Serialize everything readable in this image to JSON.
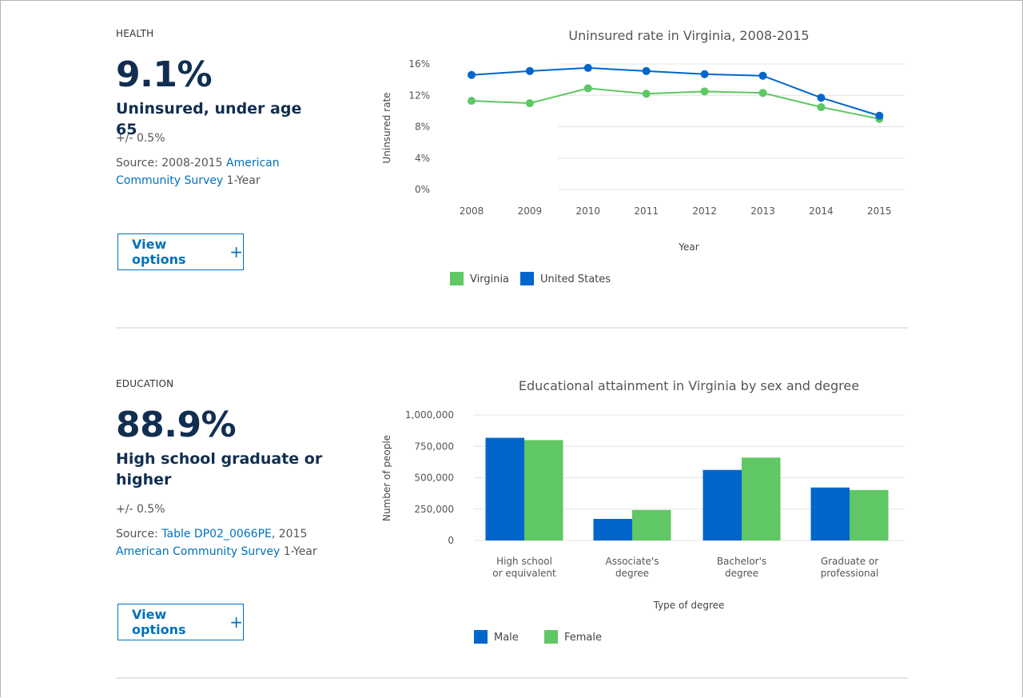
{
  "sections": [
    {
      "kicker": "HEALTH",
      "value": "9.1%",
      "label": "Uninsured, under age 65",
      "moe": "+/- 0.5%",
      "source_prefix": "Source: 2008-2015 ",
      "source_link": "American Community Survey",
      "source_suffix": " 1-Year",
      "button": "View options"
    },
    {
      "kicker": "EDUCATION",
      "value": "88.9%",
      "label": "High school graduate or higher",
      "moe": "+/- 0.5%",
      "source_prefix": "Source: ",
      "source_link": "Table DP02_0066PE",
      "source_mid": ", 2015 ",
      "source_link2": "American Community Survey",
      "source_suffix": " 1-Year",
      "button": "View options"
    }
  ],
  "chart_data": [
    {
      "type": "line",
      "title": "Uninsured rate in Virginia, 2008-2015",
      "xlabel": "Year",
      "ylabel": "Uninsured rate",
      "x": [
        "2008",
        "2009",
        "2010",
        "2011",
        "2012",
        "2013",
        "2014",
        "2015"
      ],
      "ylim": [
        0,
        16
      ],
      "yticks": [
        0,
        4,
        8,
        12,
        16
      ],
      "ytick_labels": [
        "0%",
        "4%",
        "8%",
        "12%",
        "16%"
      ],
      "series": [
        {
          "name": "Virginia",
          "color": "#5fc763",
          "values": [
            11.3,
            11.0,
            12.9,
            12.2,
            12.5,
            12.3,
            10.5,
            9.0
          ]
        },
        {
          "name": "United States",
          "color": "#0066cc",
          "values": [
            14.6,
            15.1,
            15.5,
            15.1,
            14.7,
            14.5,
            11.7,
            9.4
          ]
        }
      ],
      "legend": "bottom-left",
      "grid": true
    },
    {
      "type": "bar",
      "title": "Educational attainment in Virginia by sex and degree",
      "xlabel": "Type of degree",
      "ylabel": "Number of people",
      "categories": [
        "High school or equivalent",
        "Associate's degree",
        "Bachelor's degree",
        "Graduate or professional"
      ],
      "category_lines": [
        [
          "High school",
          "or equivalent"
        ],
        [
          "Associate's",
          "degree"
        ],
        [
          "Bachelor's",
          "degree"
        ],
        [
          "Graduate or",
          "professional"
        ]
      ],
      "ylim": [
        0,
        1000000
      ],
      "yticks": [
        0,
        250000,
        500000,
        750000,
        1000000
      ],
      "ytick_labels": [
        "0",
        "250,000",
        "500,000",
        "750,000",
        "1,000,000"
      ],
      "series": [
        {
          "name": "Male",
          "color": "#0066cc",
          "values": [
            818000,
            172000,
            562000,
            422000
          ]
        },
        {
          "name": "Female",
          "color": "#5fc763",
          "values": [
            800000,
            243000,
            660000,
            402000
          ]
        }
      ],
      "legend": "bottom-left",
      "grid": true
    }
  ]
}
